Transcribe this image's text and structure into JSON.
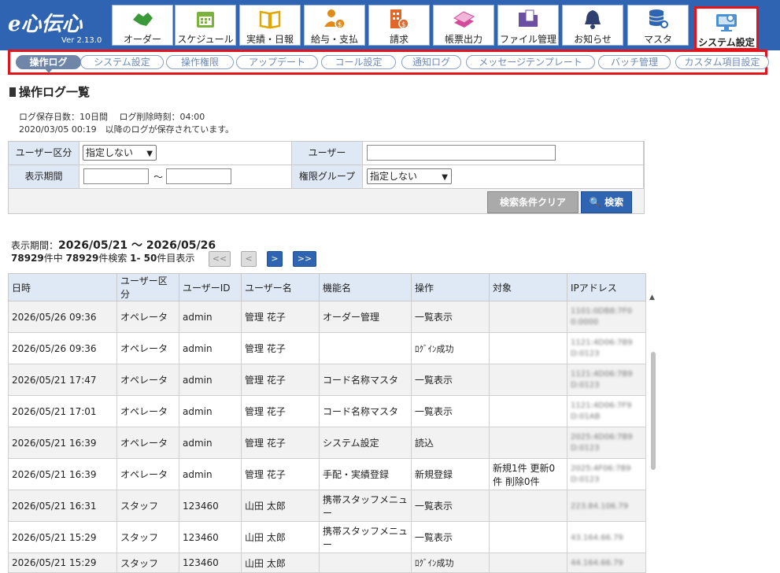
{
  "app": {
    "logo": "e心伝心",
    "version": "Ver 2.13.0"
  },
  "nav": [
    {
      "label": "オーダー",
      "icon": "handshake-icon",
      "color": "#3a9a3a"
    },
    {
      "label": "スケジュール",
      "icon": "calendar-icon",
      "color": "#7bb33a"
    },
    {
      "label": "実績・日報",
      "icon": "book-icon",
      "color": "#e0a700"
    },
    {
      "label": "給与・支払",
      "icon": "person-coin-icon",
      "color": "#e08a1a"
    },
    {
      "label": "請求",
      "icon": "building-coin-icon",
      "color": "#e0662a"
    },
    {
      "label": "帳票出力",
      "icon": "documents-icon",
      "color": "#d44a9a"
    },
    {
      "label": "ファイル管理",
      "icon": "folder-icon",
      "color": "#6a4fa3"
    },
    {
      "label": "お知らせ",
      "icon": "bell-icon",
      "color": "#2f3f70"
    },
    {
      "label": "マスタ",
      "icon": "database-icon",
      "color": "#2f64b3"
    },
    {
      "label": "システム設定",
      "icon": "monitor-gear-icon",
      "color": "#4a8fd0"
    }
  ],
  "subtabs": [
    "操作ログ",
    "システム設定",
    "操作権限",
    "アップデート",
    "コール設定",
    "通知ログ",
    "メッセージテンプレート",
    "バッチ管理",
    "カスタム項目設定"
  ],
  "page": {
    "title": "操作ログ一覧",
    "info_line1": "ログ保存日数：10日間　 ログ削除時刻：04:00",
    "info_line2": "2020/03/05 00:19　以降のログが保存されています。"
  },
  "search": {
    "user_type_label": "ユーザー区分",
    "user_type_value": "指定しない",
    "user_label": "ユーザー",
    "user_value": "",
    "period_label": "表示期間",
    "period_sep": "～",
    "perm_group_label": "権限グループ",
    "perm_group_value": "指定しない",
    "clear_button": "検索条件クリア",
    "search_button": "検索"
  },
  "result": {
    "period_label": "表示期間：",
    "period_value": "2026/05/21 ～ 2026/05/26",
    "count_total": "78929",
    "count_text1": "件中 ",
    "count_hits": "78929",
    "count_text2": "件検索 ",
    "count_range": "1- 50",
    "count_text3": "件目表示",
    "pager": [
      "<<",
      "<",
      ">",
      ">>"
    ]
  },
  "table": {
    "headers": [
      "日時",
      "ユーザー区分",
      "ユーザーID",
      "ユーザー名",
      "機能名",
      "操作",
      "対象",
      "IPアドレス"
    ],
    "rows": [
      [
        "2026/05/26 09:36",
        "オペレータ",
        "admin",
        "管理 花子",
        "オーダー管理",
        "一覧表示",
        "",
        "1101:0DB8:7F00:0000"
      ],
      [
        "2026/05/26 09:36",
        "オペレータ",
        "admin",
        "管理 花子",
        "",
        "ﾛｸﾞｲﾝ成功",
        "",
        "1121:4D06:7B9D:0123"
      ],
      [
        "2026/05/21 17:47",
        "オペレータ",
        "admin",
        "管理 花子",
        "コード名称マスタ",
        "一覧表示",
        "",
        "1121:4D06:7B9D:0123"
      ],
      [
        "2026/05/21 17:01",
        "オペレータ",
        "admin",
        "管理 花子",
        "コード名称マスタ",
        "一覧表示",
        "",
        "1121:4D06:7F9D:01AB"
      ],
      [
        "2026/05/21 16:39",
        "オペレータ",
        "admin",
        "管理 花子",
        "システム設定",
        "読込",
        "",
        "2025:4D06:7B9D:0123"
      ],
      [
        "2026/05/21 16:39",
        "オペレータ",
        "admin",
        "管理 花子",
        "手配・実績登録",
        "新規登録",
        "新規1件 更新0件 削除0件",
        "2025:4F06:7B9D:0123"
      ],
      [
        "2026/05/21 16:31",
        "スタッフ",
        "123460",
        "山田 太郎",
        "携帯スタッフメニュー",
        "一覧表示",
        "",
        "223.84.106.79"
      ],
      [
        "2026/05/21 15:29",
        "スタッフ",
        "123460",
        "山田 太郎",
        "携帯スタッフメニュー",
        "一覧表示",
        "",
        "43.164.66.79"
      ],
      [
        "2026/05/21 15:29",
        "スタッフ",
        "123460",
        "山田 太郎",
        "",
        "ﾛｸﾞｲﾝ成功",
        "",
        "44.164.66.79"
      ]
    ]
  }
}
